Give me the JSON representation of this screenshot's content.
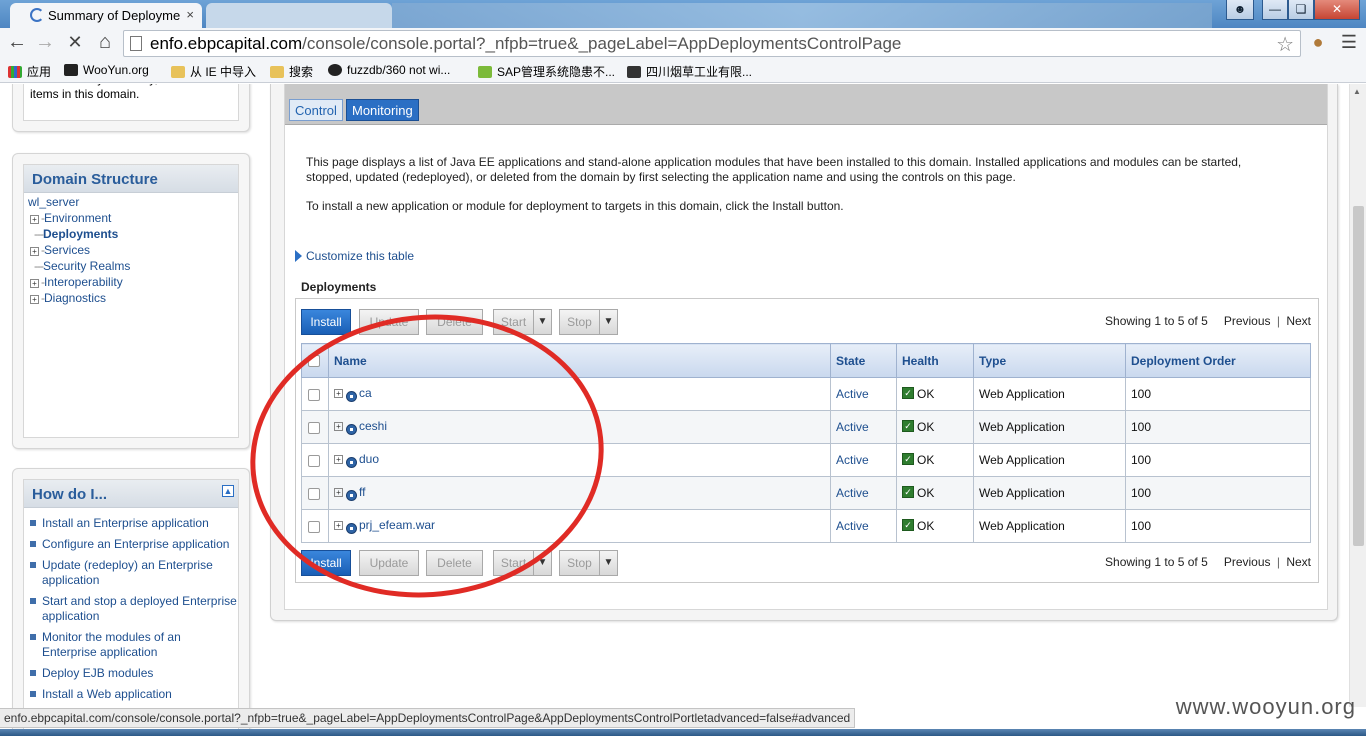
{
  "browser": {
    "active_tab": "Summary of Deployme",
    "tab_close": "×",
    "inactive_tab": "",
    "url_host": "enfo.ebpcapital.com",
    "url_path": "/console/console.portal?_nfpb=true&_pageLabel=AppDeploymentsControlPage",
    "bookmarks": [
      {
        "label": "应用"
      },
      {
        "label": "WooYun.org"
      },
      {
        "label": "从 IE 中导入"
      },
      {
        "label": "搜索"
      },
      {
        "label": "fuzzdb/360 not wi..."
      },
      {
        "label": "SAP管理系统隐患不..."
      },
      {
        "label": "四川烟草工业有限..."
      }
    ]
  },
  "left": {
    "change_center_text": "activated as you modify, add or delete items in this domain.",
    "domain_structure": {
      "title": "Domain Structure",
      "root": "wl_server",
      "items": [
        "Environment",
        "Deployments",
        "Services",
        "Security Realms",
        "Interoperability",
        "Diagnostics"
      ]
    },
    "how_do_i": {
      "title": "How do I...",
      "items": [
        "Install an Enterprise application",
        "Configure an Enterprise application",
        "Update (redeploy) an Enterprise application",
        "Start and stop a deployed Enterprise application",
        "Monitor the modules of an Enterprise application",
        "Deploy EJB modules",
        "Install a Web application"
      ]
    }
  },
  "content": {
    "tabs": [
      "Control",
      "Monitoring"
    ],
    "description_1": "This page displays a list of Java EE applications and stand-alone application modules that have been installed to this domain. Installed applications and modules can be started, stopped, updated (redeployed), or deleted from the domain by first selecting the application name and using the controls on this page.",
    "description_2": "To install a new application or module for deployment to targets in this domain, click the Install button.",
    "customize": "Customize this table",
    "table_title": "Deployments",
    "buttons": {
      "install": "Install",
      "update": "Update",
      "delete": "Delete",
      "start": "Start",
      "stop": "Stop"
    },
    "paging": {
      "showing": "Showing 1 to 5 of 5",
      "previous": "Previous",
      "next": "Next"
    },
    "columns": [
      "Name",
      "State",
      "Health",
      "Type",
      "Deployment Order"
    ],
    "rows": [
      {
        "name": "ca",
        "state": "Active",
        "health": "OK",
        "type": "Web Application",
        "order": "100"
      },
      {
        "name": "ceshi",
        "state": "Active",
        "health": "OK",
        "type": "Web Application",
        "order": "100"
      },
      {
        "name": "duo",
        "state": "Active",
        "health": "OK",
        "type": "Web Application",
        "order": "100"
      },
      {
        "name": "ff",
        "state": "Active",
        "health": "OK",
        "type": "Web Application",
        "order": "100"
      },
      {
        "name": "prj_efeam.war",
        "state": "Active",
        "health": "OK",
        "type": "Web Application",
        "order": "100"
      }
    ]
  },
  "statusbar": "enfo.ebpcapital.com/console/console.portal?_nfpb=true&_pageLabel=AppDeploymentsControlPage&AppDeploymentsControlPortletadvanced=false#advanced",
  "watermark": "www.wooyun.org",
  "colors": {
    "accent": "#2b6fc4",
    "link": "#1e4f8f",
    "annotation": "#e02b25",
    "ok": "#2f7d2f"
  },
  "icons": [
    "back-icon",
    "forward-icon",
    "reload-icon",
    "home-icon",
    "star-icon",
    "cookie-icon",
    "menu-icon",
    "plus-expand-icon",
    "app-icon",
    "ok-check-icon",
    "dropdown-arrow-icon",
    "triangle-right-icon"
  ]
}
